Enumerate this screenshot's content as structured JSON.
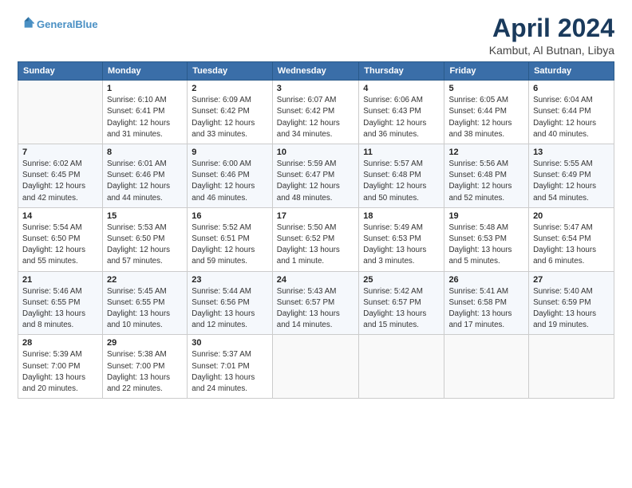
{
  "header": {
    "logo_line1": "General",
    "logo_line2": "Blue",
    "title": "April 2024",
    "subtitle": "Kambut, Al Butnan, Libya"
  },
  "days_of_week": [
    "Sunday",
    "Monday",
    "Tuesday",
    "Wednesday",
    "Thursday",
    "Friday",
    "Saturday"
  ],
  "weeks": [
    [
      {
        "day": "",
        "info": ""
      },
      {
        "day": "1",
        "info": "Sunrise: 6:10 AM\nSunset: 6:41 PM\nDaylight: 12 hours\nand 31 minutes."
      },
      {
        "day": "2",
        "info": "Sunrise: 6:09 AM\nSunset: 6:42 PM\nDaylight: 12 hours\nand 33 minutes."
      },
      {
        "day": "3",
        "info": "Sunrise: 6:07 AM\nSunset: 6:42 PM\nDaylight: 12 hours\nand 34 minutes."
      },
      {
        "day": "4",
        "info": "Sunrise: 6:06 AM\nSunset: 6:43 PM\nDaylight: 12 hours\nand 36 minutes."
      },
      {
        "day": "5",
        "info": "Sunrise: 6:05 AM\nSunset: 6:44 PM\nDaylight: 12 hours\nand 38 minutes."
      },
      {
        "day": "6",
        "info": "Sunrise: 6:04 AM\nSunset: 6:44 PM\nDaylight: 12 hours\nand 40 minutes."
      }
    ],
    [
      {
        "day": "7",
        "info": "Sunrise: 6:02 AM\nSunset: 6:45 PM\nDaylight: 12 hours\nand 42 minutes."
      },
      {
        "day": "8",
        "info": "Sunrise: 6:01 AM\nSunset: 6:46 PM\nDaylight: 12 hours\nand 44 minutes."
      },
      {
        "day": "9",
        "info": "Sunrise: 6:00 AM\nSunset: 6:46 PM\nDaylight: 12 hours\nand 46 minutes."
      },
      {
        "day": "10",
        "info": "Sunrise: 5:59 AM\nSunset: 6:47 PM\nDaylight: 12 hours\nand 48 minutes."
      },
      {
        "day": "11",
        "info": "Sunrise: 5:57 AM\nSunset: 6:48 PM\nDaylight: 12 hours\nand 50 minutes."
      },
      {
        "day": "12",
        "info": "Sunrise: 5:56 AM\nSunset: 6:48 PM\nDaylight: 12 hours\nand 52 minutes."
      },
      {
        "day": "13",
        "info": "Sunrise: 5:55 AM\nSunset: 6:49 PM\nDaylight: 12 hours\nand 54 minutes."
      }
    ],
    [
      {
        "day": "14",
        "info": "Sunrise: 5:54 AM\nSunset: 6:50 PM\nDaylight: 12 hours\nand 55 minutes."
      },
      {
        "day": "15",
        "info": "Sunrise: 5:53 AM\nSunset: 6:50 PM\nDaylight: 12 hours\nand 57 minutes."
      },
      {
        "day": "16",
        "info": "Sunrise: 5:52 AM\nSunset: 6:51 PM\nDaylight: 12 hours\nand 59 minutes."
      },
      {
        "day": "17",
        "info": "Sunrise: 5:50 AM\nSunset: 6:52 PM\nDaylight: 13 hours\nand 1 minute."
      },
      {
        "day": "18",
        "info": "Sunrise: 5:49 AM\nSunset: 6:53 PM\nDaylight: 13 hours\nand 3 minutes."
      },
      {
        "day": "19",
        "info": "Sunrise: 5:48 AM\nSunset: 6:53 PM\nDaylight: 13 hours\nand 5 minutes."
      },
      {
        "day": "20",
        "info": "Sunrise: 5:47 AM\nSunset: 6:54 PM\nDaylight: 13 hours\nand 6 minutes."
      }
    ],
    [
      {
        "day": "21",
        "info": "Sunrise: 5:46 AM\nSunset: 6:55 PM\nDaylight: 13 hours\nand 8 minutes."
      },
      {
        "day": "22",
        "info": "Sunrise: 5:45 AM\nSunset: 6:55 PM\nDaylight: 13 hours\nand 10 minutes."
      },
      {
        "day": "23",
        "info": "Sunrise: 5:44 AM\nSunset: 6:56 PM\nDaylight: 13 hours\nand 12 minutes."
      },
      {
        "day": "24",
        "info": "Sunrise: 5:43 AM\nSunset: 6:57 PM\nDaylight: 13 hours\nand 14 minutes."
      },
      {
        "day": "25",
        "info": "Sunrise: 5:42 AM\nSunset: 6:57 PM\nDaylight: 13 hours\nand 15 minutes."
      },
      {
        "day": "26",
        "info": "Sunrise: 5:41 AM\nSunset: 6:58 PM\nDaylight: 13 hours\nand 17 minutes."
      },
      {
        "day": "27",
        "info": "Sunrise: 5:40 AM\nSunset: 6:59 PM\nDaylight: 13 hours\nand 19 minutes."
      }
    ],
    [
      {
        "day": "28",
        "info": "Sunrise: 5:39 AM\nSunset: 7:00 PM\nDaylight: 13 hours\nand 20 minutes."
      },
      {
        "day": "29",
        "info": "Sunrise: 5:38 AM\nSunset: 7:00 PM\nDaylight: 13 hours\nand 22 minutes."
      },
      {
        "day": "30",
        "info": "Sunrise: 5:37 AM\nSunset: 7:01 PM\nDaylight: 13 hours\nand 24 minutes."
      },
      {
        "day": "",
        "info": ""
      },
      {
        "day": "",
        "info": ""
      },
      {
        "day": "",
        "info": ""
      },
      {
        "day": "",
        "info": ""
      }
    ]
  ]
}
